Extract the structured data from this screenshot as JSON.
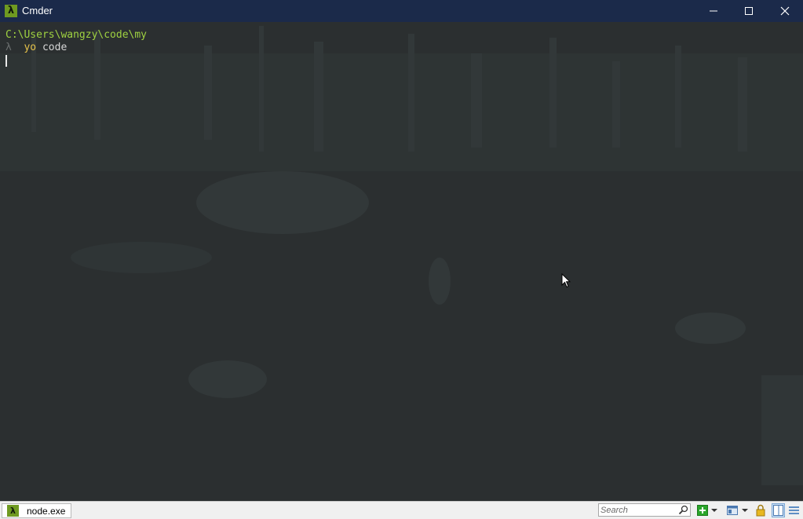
{
  "window": {
    "title": "Cmder"
  },
  "colors": {
    "titlebar": "#1b2a4a",
    "console_bg": "#2b2f30",
    "path": "#9fd241",
    "command": "#e6c34a",
    "lambda": "#6b6f6f",
    "brand": "#6f9a21"
  },
  "icons": {
    "app": "lambda-icon",
    "minimize": "minimize-icon",
    "maximize": "maximize-icon",
    "close": "close-icon",
    "search": "search-icon",
    "add_console": "plus-icon",
    "view": "window-icon",
    "lock": "lock-icon",
    "split": "split-view-icon",
    "list": "list-icon"
  },
  "console": {
    "path": "C:\\Users\\wangzy\\code\\my",
    "prompt_symbol": "λ",
    "command": "yo",
    "argument": "code"
  },
  "statusbar": {
    "tab_icon_glyph": "λ",
    "tab_label": "node.exe",
    "search_placeholder": "Search"
  }
}
